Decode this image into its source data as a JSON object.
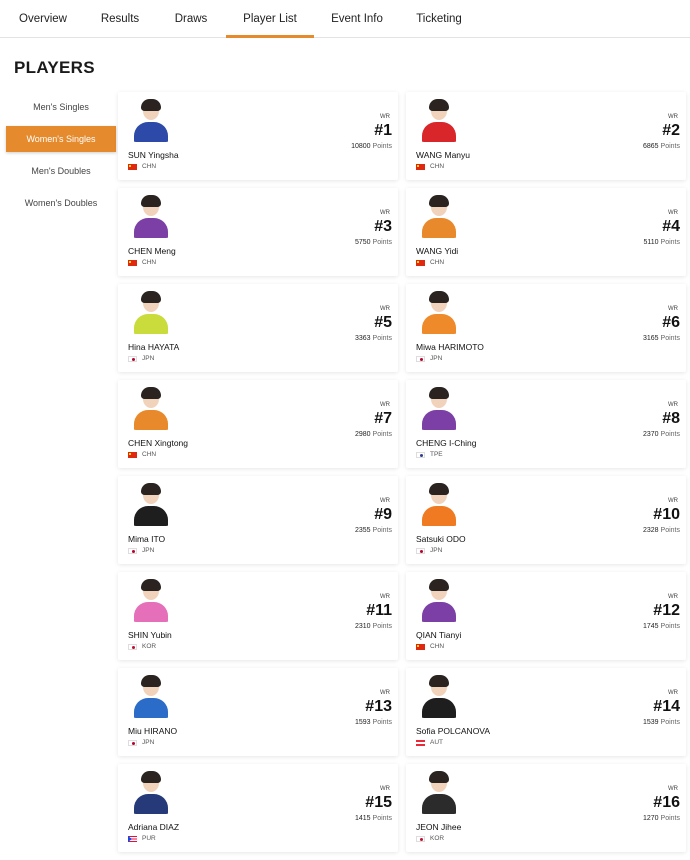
{
  "nav": {
    "tabs": [
      {
        "label": "Overview",
        "active": false
      },
      {
        "label": "Results",
        "active": false
      },
      {
        "label": "Draws",
        "active": false
      },
      {
        "label": "Player List",
        "active": true
      },
      {
        "label": "Event Info",
        "active": false
      },
      {
        "label": "Ticketing",
        "active": false
      }
    ],
    "accent_color": "#e58a2d"
  },
  "page_title": "PLAYERS",
  "sidebar": {
    "items": [
      {
        "label": "Men's Singles",
        "active": false
      },
      {
        "label": "Women's Singles",
        "active": true
      },
      {
        "label": "Men's Doubles",
        "active": false
      },
      {
        "label": "Women's Doubles",
        "active": false
      }
    ]
  },
  "rank_label": "WR",
  "points_label": "Points",
  "players": [
    {
      "name": "SUN Yingsha",
      "country": "CHN",
      "rank": "#1",
      "points": "10800",
      "shirt_color": "#2d4aa8"
    },
    {
      "name": "WANG Manyu",
      "country": "CHN",
      "rank": "#2",
      "points": "6865",
      "shirt_color": "#d8262b"
    },
    {
      "name": "CHEN Meng",
      "country": "CHN",
      "rank": "#3",
      "points": "5750",
      "shirt_color": "#7b3fa6"
    },
    {
      "name": "WANG Yidi",
      "country": "CHN",
      "rank": "#4",
      "points": "5110",
      "shirt_color": "#e8892b"
    },
    {
      "name": "Hina HAYATA",
      "country": "JPN",
      "rank": "#5",
      "points": "3363",
      "shirt_color": "#c9dc3c"
    },
    {
      "name": "Miwa HARIMOTO",
      "country": "JPN",
      "rank": "#6",
      "points": "3165",
      "shirt_color": "#ef8a2a"
    },
    {
      "name": "CHEN Xingtong",
      "country": "CHN",
      "rank": "#7",
      "points": "2980",
      "shirt_color": "#e8892b"
    },
    {
      "name": "CHENG I-Ching",
      "country": "TPE",
      "rank": "#8",
      "points": "2370",
      "shirt_color": "#7b3fa6"
    },
    {
      "name": "Mima ITO",
      "country": "JPN",
      "rank": "#9",
      "points": "2355",
      "shirt_color": "#1e1e1e"
    },
    {
      "name": "Satsuki ODO",
      "country": "JPN",
      "rank": "#10",
      "points": "2328",
      "shirt_color": "#ef7a22"
    },
    {
      "name": "SHIN Yubin",
      "country": "KOR",
      "rank": "#11",
      "points": "2310",
      "shirt_color": "#e56fb8"
    },
    {
      "name": "QIAN Tianyi",
      "country": "CHN",
      "rank": "#12",
      "points": "1745",
      "shirt_color": "#7b3fa6"
    },
    {
      "name": "Miu HIRANO",
      "country": "JPN",
      "rank": "#13",
      "points": "1593",
      "shirt_color": "#2a6cc7"
    },
    {
      "name": "Sofia POLCANOVA",
      "country": "AUT",
      "rank": "#14",
      "points": "1539",
      "shirt_color": "#1e1e1e"
    },
    {
      "name": "Adriana DIAZ",
      "country": "PUR",
      "rank": "#15",
      "points": "1415",
      "shirt_color": "#263a7a"
    },
    {
      "name": "JEON Jihee",
      "country": "KOR",
      "rank": "#16",
      "points": "1270",
      "shirt_color": "#2b2b2b"
    }
  ],
  "flag_colors": {
    "CHN": [
      "#de2910",
      "#ffde00"
    ],
    "JPN": [
      "#ffffff",
      "#bc002d"
    ],
    "TPE": [
      "#ffffff",
      "#2e3f8f"
    ],
    "KOR": [
      "#ffffff",
      "#c60c30"
    ],
    "AUT": [
      "#ed2939",
      "#ffffff"
    ],
    "PUR": [
      "#ed0a3f",
      "#0050f0"
    ]
  }
}
